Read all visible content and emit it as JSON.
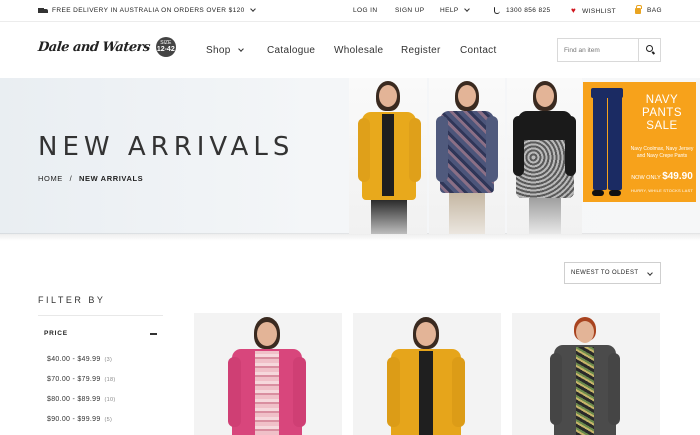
{
  "topbar": {
    "delivery": "FREE DELIVERY IN AUSTRALIA ON ORDERS OVER $120",
    "login": "LOG IN",
    "signup": "SIGN UP",
    "help": "HELP",
    "phone": "1300 856 825",
    "wishlist": "WISHLIST",
    "bag": "BAG"
  },
  "logo": {
    "text": "Dale and Waters",
    "badge_top": "SIZE",
    "badge_main": "12-42"
  },
  "nav": {
    "shop": "Shop",
    "catalogue": "Catalogue",
    "wholesale": "Wholesale",
    "register": "Register",
    "contact": "Contact"
  },
  "search": {
    "placeholder": "Find an item"
  },
  "hero": {
    "title": "NEW ARRIVALS",
    "breadcrumb_home": "HOME",
    "breadcrumb_sep": "/",
    "breadcrumb_current": "NEW ARRIVALS"
  },
  "promo": {
    "title_1": "NAVY",
    "title_2": "PANTS",
    "title_3": "SALE",
    "sub": "Navy Coolmax, Navy Jersey and Navy Crepe Pants",
    "price_prefix": "NOW ONLY",
    "price": "$49.90",
    "note": "HURRY, WHILE STOCKS LAST"
  },
  "sort": {
    "selected": "NEWEST TO OLDEST"
  },
  "filter": {
    "heading": "FILTER BY",
    "price_label": "PRICE",
    "ranges": [
      {
        "label": "$40.00 - $49.99",
        "count": "(3)"
      },
      {
        "label": "$70.00 - $79.99",
        "count": "(18)"
      },
      {
        "label": "$80.00 - $89.99",
        "count": "(10)"
      },
      {
        "label": "$90.00 - $99.99",
        "count": "(5)"
      }
    ]
  },
  "colors": {
    "accent_orange": "#f7a21b",
    "wishlist_red": "#d0161e",
    "navy": "#1b2b63"
  }
}
